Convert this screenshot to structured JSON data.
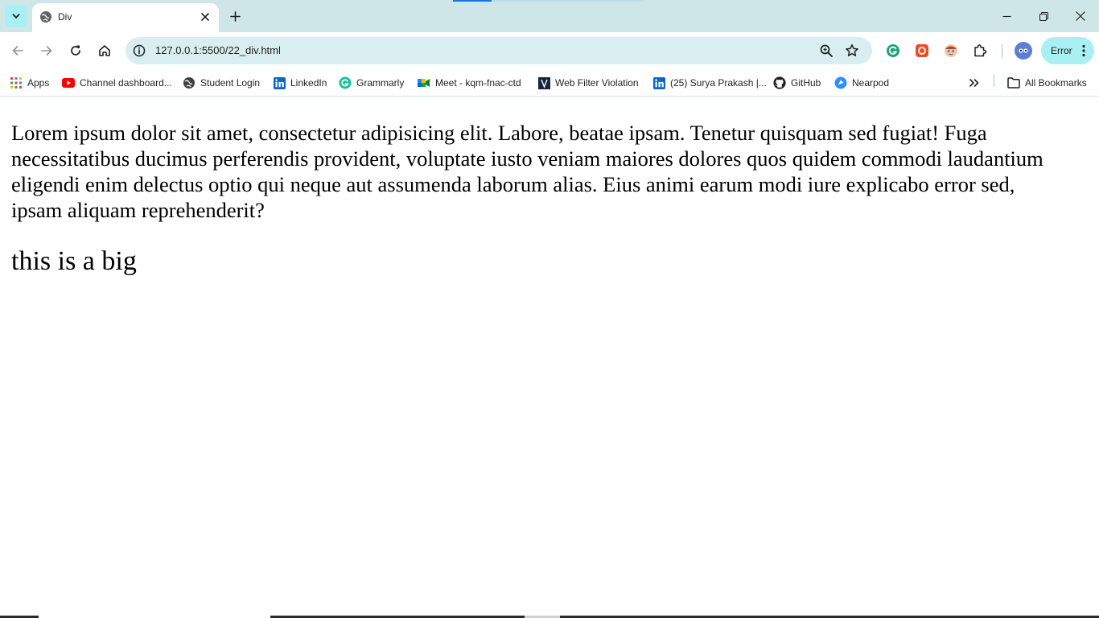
{
  "browser": {
    "tab": {
      "title": "Div"
    },
    "address": {
      "url": "127.0.0.1:5500/22_div.html"
    },
    "profile": {
      "error_label": "Error"
    },
    "colors": {
      "accent": "#1a73e8",
      "chrome_bg": "#cfe6e9",
      "omnibox_bg": "#d9eef0",
      "error_bg": "#a8f0f4"
    }
  },
  "bookmarks": {
    "items": [
      {
        "label": "Apps",
        "icon": "apps-grid-icon"
      },
      {
        "label": "Channel dashboard...",
        "icon": "youtube-icon"
      },
      {
        "label": "Student Login",
        "icon": "globe-icon"
      },
      {
        "label": "LinkedIn",
        "icon": "linkedin-icon"
      },
      {
        "label": "Grammarly",
        "icon": "grammarly-icon"
      },
      {
        "label": "Meet - kqm-fnac-ctd",
        "icon": "google-meet-icon"
      },
      {
        "label": "Web Filter Violation",
        "icon": "web-filter-icon"
      },
      {
        "label": "(25) Surya Prakash |...",
        "icon": "linkedin-icon"
      },
      {
        "label": "GitHub",
        "icon": "github-icon"
      },
      {
        "label": "Nearpod",
        "icon": "nearpod-icon"
      }
    ],
    "all_bookmarks": "All Bookmarks"
  },
  "page": {
    "paragraph": "Lorem ipsum dolor sit amet, consectetur adipisicing elit. Labore, beatae ipsam. Tenetur quisquam sed fugiat! Fuga necessitatibus ducimus perferendis provident, voluptate iusto veniam maiores dolores quos quidem commodi laudantium eligendi enim delectus optio qui neque aut assumenda laborum alias. Eius animi earum modi iure explicabo error sed, ipsam aliquam reprehenderit?",
    "big_text": "this is a big"
  }
}
